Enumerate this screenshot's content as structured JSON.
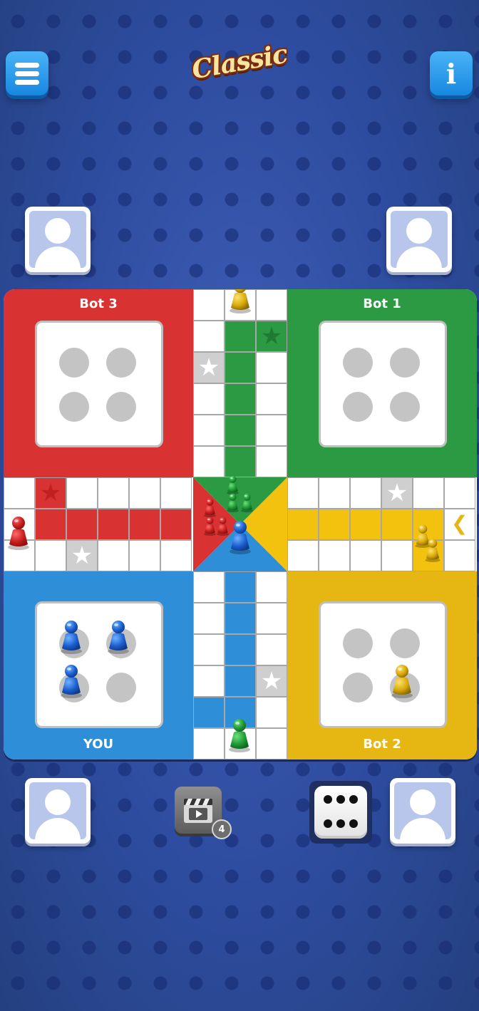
{
  "header": {
    "logo_text": "Classic",
    "menu_icon": "hamburger-icon",
    "info_icon": "info-icon",
    "info_glyph": "i"
  },
  "players": {
    "top_left": "Bot 3",
    "top_right": "Bot 1",
    "bottom_left": "YOU",
    "bottom_right": "Bot 2"
  },
  "colors": {
    "red": "#d83232",
    "green": "#2b9a43",
    "blue": "#2e8fd8",
    "yellow": "#e6b712",
    "background": "#2e4c9f"
  },
  "yards": {
    "red": [
      "empty",
      "empty",
      "empty",
      "empty"
    ],
    "green": [
      "empty",
      "empty",
      "empty",
      "empty"
    ],
    "blue": [
      "blue",
      "blue",
      "blue",
      "empty"
    ],
    "yellow": [
      "empty",
      "empty",
      "empty",
      "yellow"
    ]
  },
  "controls": {
    "video_reward_icon": "clapperboard-play-icon",
    "video_reward_count": "4",
    "dice_icon": "dice-icon",
    "dice_value": 6
  }
}
